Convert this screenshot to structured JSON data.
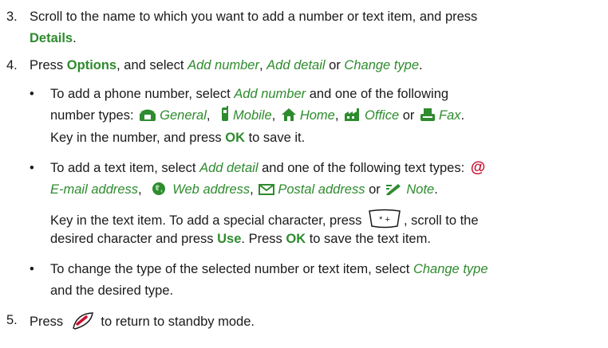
{
  "step3": {
    "num": "3.",
    "text1": "Scroll to the name to which you want to add a number or text item, and press",
    "details": "Details",
    "end": "."
  },
  "step4": {
    "num": "4.",
    "press": "Press",
    "options": "Options",
    "select": ", and select",
    "add_number": "Add number",
    "comma1": ",",
    "add_detail": "Add detail",
    "or": "or",
    "change_type": "Change type",
    "end": "."
  },
  "bullet1": {
    "line1a": "To add a phone number, select",
    "add_number": "Add number",
    "line1b": "and one of the following",
    "line2a": "number types:",
    "general": "General",
    "mobile": "Mobile",
    "home": "Home",
    "office": "Office",
    "or": "or",
    "fax": "Fax",
    "comma": ",",
    "end": ".",
    "line3a": "Key in the number, and press",
    "ok": "OK",
    "line3b": "to save it."
  },
  "bullet2": {
    "line1a": "To add a text item, select",
    "add_detail": "Add detail",
    "line1b": "and one of the following text types:",
    "email": "E-mail address",
    "web": "Web address",
    "postal": "Postal address",
    "or": "or",
    "note": "Note",
    "comma": ",",
    "end": ".",
    "line3a": "Key in the text item. To add a special character, press",
    "line3b": ", scroll to the",
    "line4a": "desired character and press",
    "use": "Use",
    "line4b": ". Press",
    "ok": "OK",
    "line4c": "to save the text item."
  },
  "bullet3": {
    "line1a": "To change the type of the selected number or text item, select",
    "change_type": "Change type",
    "line2": "and the desired type."
  },
  "step5": {
    "num": "5.",
    "press": "Press",
    "rest": "to return to standby mode."
  },
  "icons": {
    "bullet": "•",
    "at": "@",
    "star_key": "* +"
  }
}
